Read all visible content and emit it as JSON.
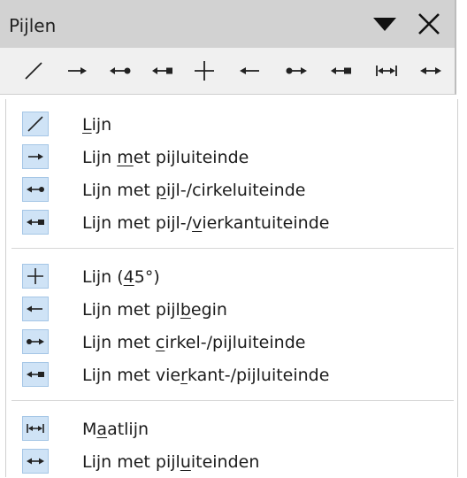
{
  "panel": {
    "title": "Pijlen"
  },
  "toolbar": {
    "icons": [
      "line-icon",
      "line-arrow-end-icon",
      "line-arrow-circle-icon",
      "line-arrow-square-icon",
      "cross-45-icon",
      "line-arrow-start-icon",
      "line-circle-arrow-icon",
      "line-square-arrow-icon",
      "dimension-line-icon",
      "line-arrows-icon"
    ]
  },
  "menu": {
    "items": [
      {
        "pre": "",
        "key": "L",
        "post": "ijn",
        "icon": "line-icon"
      },
      {
        "pre": "Lijn ",
        "key": "m",
        "post": "et pijluiteinde",
        "icon": "line-arrow-end-icon"
      },
      {
        "pre": "Lijn met ",
        "key": "p",
        "post": "ijl-/cirkeluiteinde",
        "icon": "line-arrow-circle-icon"
      },
      {
        "pre": "Lijn met pijl-/",
        "key": "v",
        "post": "ierkantuiteinde",
        "icon": "line-arrow-square-icon"
      },
      {
        "pre": "Lijn (",
        "key": "4",
        "post": "5°)",
        "icon": "cross-45-icon"
      },
      {
        "pre": "Lijn met pijl",
        "key": "b",
        "post": "egin",
        "icon": "line-arrow-start-icon"
      },
      {
        "pre": "Lijn met ",
        "key": "c",
        "post": "irkel-/pijluiteinde",
        "icon": "line-circle-arrow-icon"
      },
      {
        "pre": "Lijn met vie",
        "key": "r",
        "post": "kant-/pijluiteinde",
        "icon": "line-square-arrow-icon"
      },
      {
        "pre": "M",
        "key": "a",
        "post": "atlijn",
        "icon": "dimension-line-icon"
      },
      {
        "pre": "Lijn met pijl",
        "key": "u",
        "post": "iteinden",
        "icon": "line-arrows-icon"
      }
    ]
  }
}
